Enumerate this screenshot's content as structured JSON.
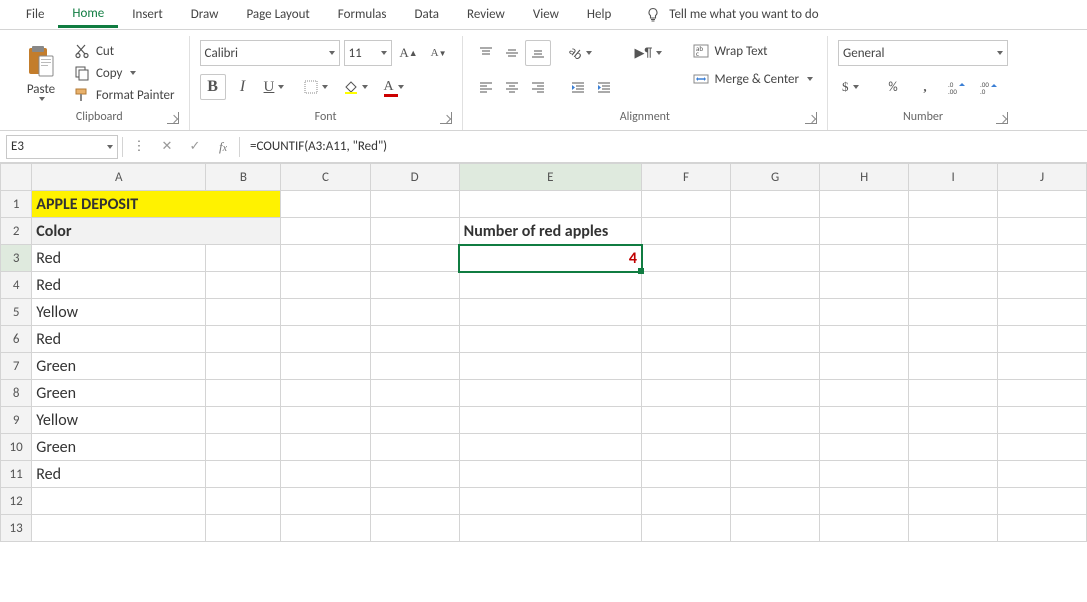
{
  "tabs": {
    "file": "File",
    "home": "Home",
    "insert": "Insert",
    "draw": "Draw",
    "pagelayout": "Page Layout",
    "formulas": "Formulas",
    "data": "Data",
    "review": "Review",
    "view": "View",
    "help": "Help",
    "tell": "Tell me what you want to do"
  },
  "ribbon": {
    "paste": "Paste",
    "cut": "Cut",
    "copy": "Copy",
    "format_painter": "Format Painter",
    "clipboard": "Clipboard",
    "font_name": "Calibri",
    "font_size": "11",
    "font": "Font",
    "wrap_text": "Wrap Text",
    "merge_center": "Merge & Center",
    "alignment": "Alignment",
    "number_format": "General",
    "number": "Number"
  },
  "formula_bar": {
    "cell_ref": "E3",
    "formula": "=COUNTIF(A3:A11, \"Red\")"
  },
  "columns": [
    "A",
    "B",
    "C",
    "D",
    "E",
    "F",
    "G",
    "H",
    "I",
    "J"
  ],
  "rows": [
    "1",
    "2",
    "3",
    "4",
    "5",
    "6",
    "7",
    "8",
    "9",
    "10",
    "11",
    "12",
    "13"
  ],
  "cells": {
    "A1": "APPLE DEPOSIT",
    "A2": "Color",
    "A3": "Red",
    "A4": "Red",
    "A5": "Yellow",
    "A6": "Red",
    "A7": "Green",
    "A8": "Green",
    "A9": "Yellow",
    "A10": "Green",
    "A11": "Red",
    "E2": "Number of red apples",
    "E3": "4"
  }
}
